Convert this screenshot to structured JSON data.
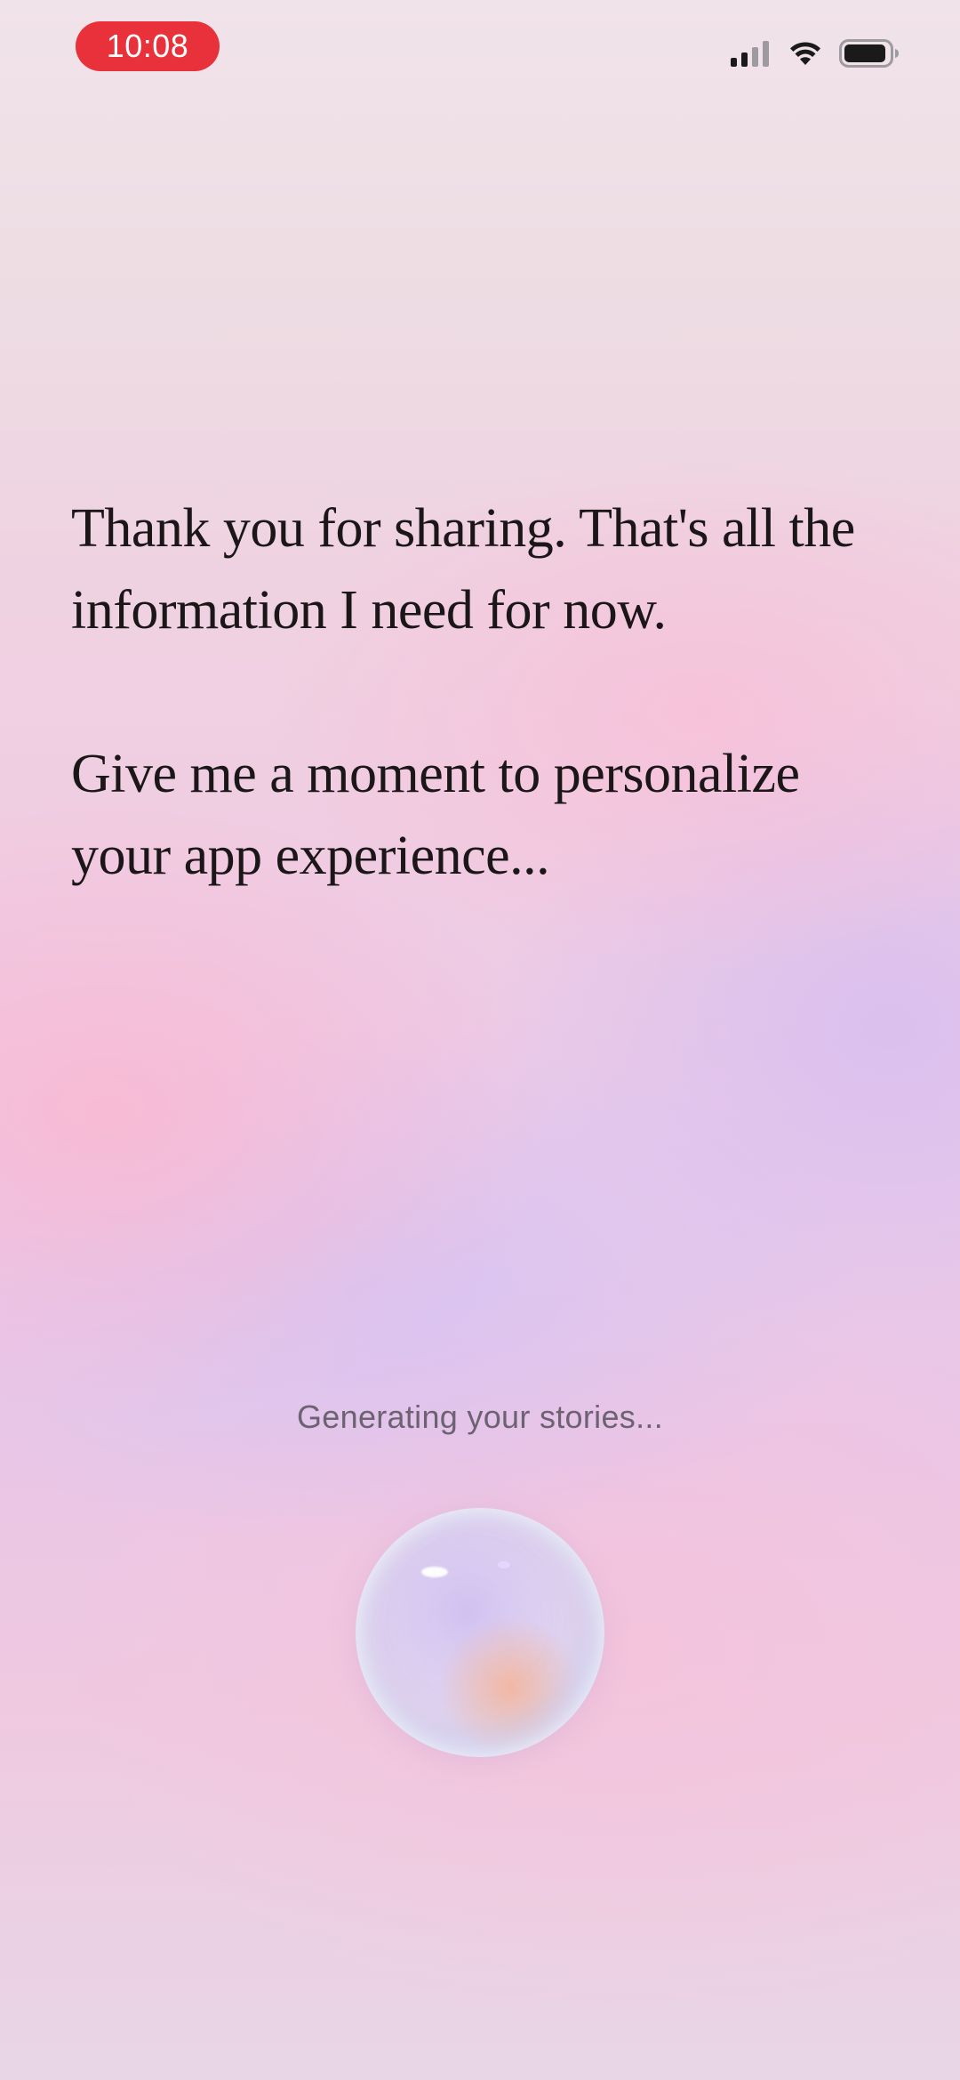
{
  "status_bar": {
    "time": "10:08",
    "time_pill_color": "#e8313a",
    "icons": [
      "cellular-signal-icon",
      "wifi-icon",
      "battery-icon"
    ]
  },
  "main": {
    "message_line_1": "Thank you for sharing. That's all the information I need for now.",
    "message_line_2": "Give me a moment to personalize your app experience...",
    "status_text": "Generating your stories..."
  },
  "loader": {
    "icon": "orb-loader-icon"
  }
}
